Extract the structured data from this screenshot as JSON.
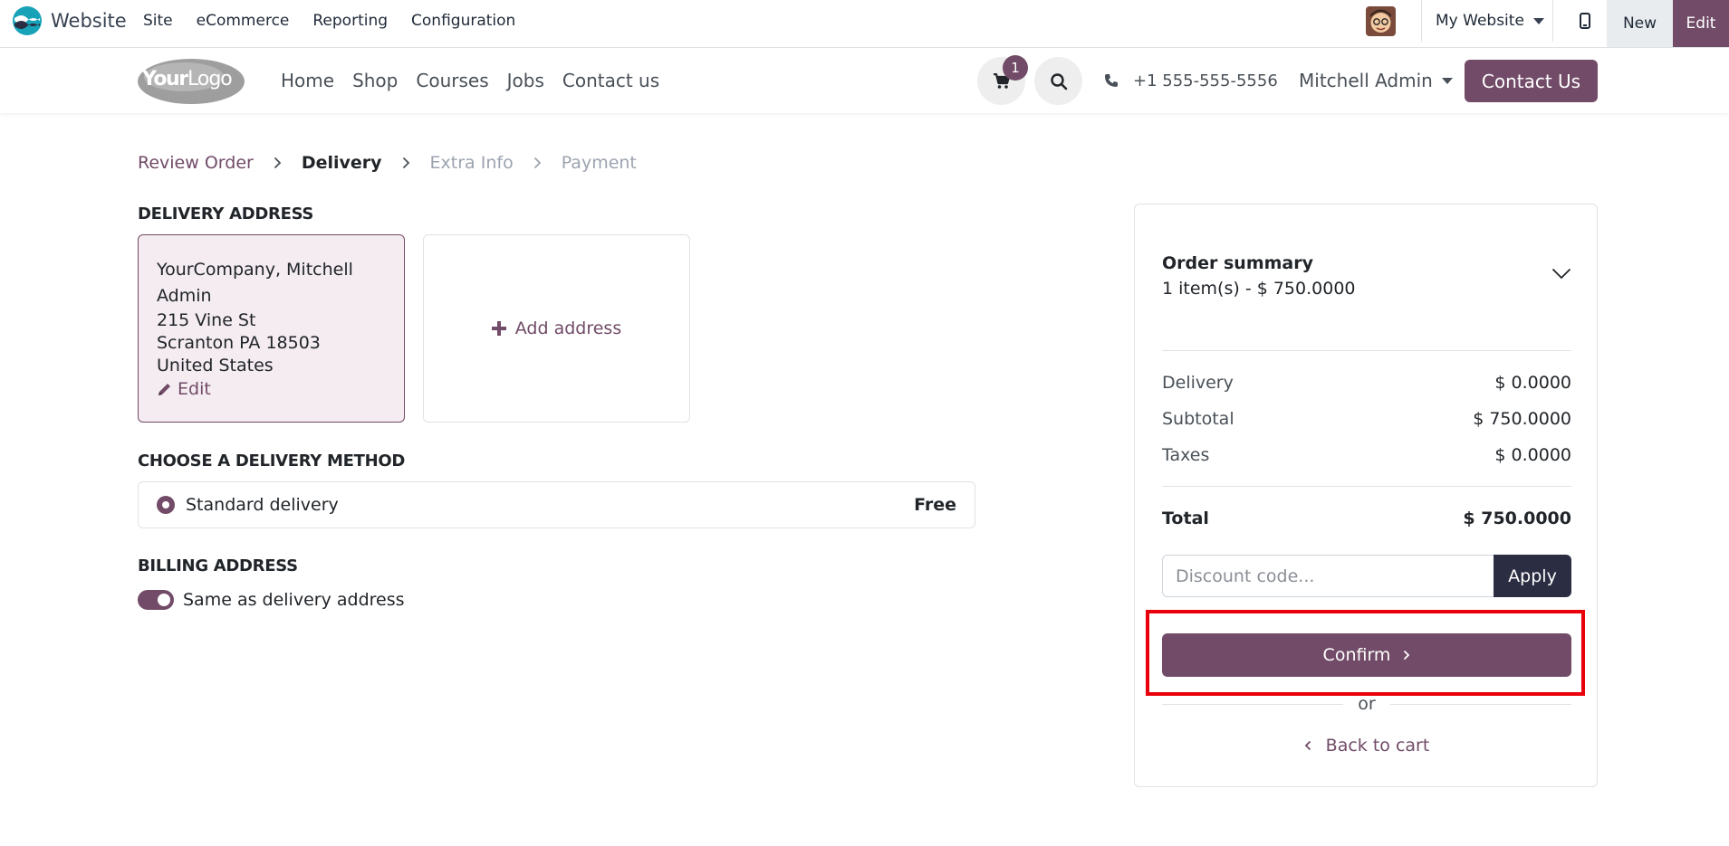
{
  "admin_bar": {
    "app_name": "Website",
    "menu": [
      "Site",
      "eCommerce",
      "Reporting",
      "Configuration"
    ],
    "website_selector": "My Website",
    "new_label": "New",
    "edit_label": "Edit"
  },
  "header": {
    "nav": [
      "Home",
      "Shop",
      "Courses",
      "Jobs",
      "Contact us"
    ],
    "cart_count": "1",
    "phone": "+1 555-555-5556",
    "user": "Mitchell Admin",
    "contact_button": "Contact Us"
  },
  "steps": {
    "review": "Review Order",
    "delivery": "Delivery",
    "extra": "Extra Info",
    "payment": "Payment"
  },
  "delivery_address": {
    "title": "DELIVERY ADDRESS",
    "name_line1": "YourCompany, Mitchell",
    "name_line2": "Admin",
    "street": "215 Vine St",
    "city_line": "Scranton PA 18503",
    "country": "United States",
    "edit_label": "Edit",
    "add_label": "Add address"
  },
  "delivery_method": {
    "title": "CHOOSE A DELIVERY METHOD",
    "name": "Standard delivery",
    "price": "Free"
  },
  "billing": {
    "title": "BILLING ADDRESS",
    "same_label": "Same as delivery address"
  },
  "summary": {
    "title": "Order summary",
    "items_line": "1 item(s) -  $ 750.0000",
    "delivery_label": "Delivery",
    "delivery_value": "$ 0.0000",
    "subtotal_label": "Subtotal",
    "subtotal_value": "$ 750.0000",
    "taxes_label": "Taxes",
    "taxes_value": "$ 0.0000",
    "total_label": "Total",
    "total_value": "$ 750.0000",
    "discount_placeholder": "Discount code...",
    "apply_label": "Apply",
    "confirm_label": "Confirm",
    "or_label": "or",
    "back_label": "Back to cart"
  },
  "colors": {
    "brand": "#714b67",
    "dark_button": "#2b2d42",
    "highlight": "#e8000b"
  }
}
